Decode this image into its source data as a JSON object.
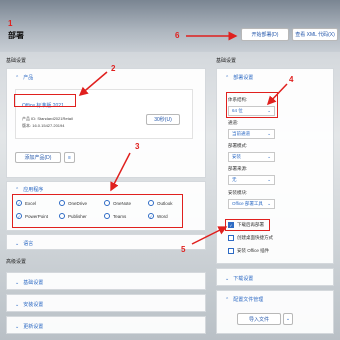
{
  "page": {
    "title": "部署",
    "marks": [
      "1",
      "2",
      "3",
      "4",
      "5",
      "6"
    ]
  },
  "toolbar": {
    "start_deploy": "开始部署(D)",
    "view_xml": "查看 XML 代码(X)"
  },
  "left": {
    "basic_settings": "基础设置",
    "products": {
      "header": "产品",
      "product_name": "Office 标准版 2021",
      "product_id": "产品 ID: Standard2021Retail",
      "version": "版本: 16.0.15427.20194",
      "remove_button": "30秒(U)",
      "add_product_button": "添加产品(D)"
    },
    "apps": {
      "header": "应用程序",
      "items": [
        "Excel",
        "OneDrive",
        "OneNote",
        "Outlook",
        "PowerPoint",
        "Publisher",
        "Teams",
        "Word"
      ],
      "checked": [
        "true",
        "false",
        "false",
        "false",
        "true",
        "false",
        "false",
        "true"
      ]
    },
    "language": {
      "header": "语言"
    },
    "advanced_settings": "高级设置",
    "collapsed": [
      "基础设置",
      "安装设置",
      "更新设置"
    ]
  },
  "right": {
    "deploy_settings": "部署设置",
    "arch_label": "体系结构:",
    "arch_value": "64 位",
    "channel_label": "通道:",
    "channel_value": "当前通道",
    "deploy_mode_label": "部署模式:",
    "deploy_mode_value": "安装",
    "deploy_source_label": "部署来源:",
    "deploy_source_value": "无",
    "install_module_label": "安装模块:",
    "install_module_value": "Office 部署工具",
    "options": [
      "下载后再部署",
      "创建桌面快捷方式",
      "安装 Office 插件"
    ],
    "options_checked": [
      "true",
      "false",
      "false"
    ],
    "download_settings": "下载设置",
    "config_file": "配置文件管理",
    "import_button": "导入文件"
  },
  "colors": {
    "annotation": "#e0201e",
    "accent": "#2d6ac4"
  }
}
